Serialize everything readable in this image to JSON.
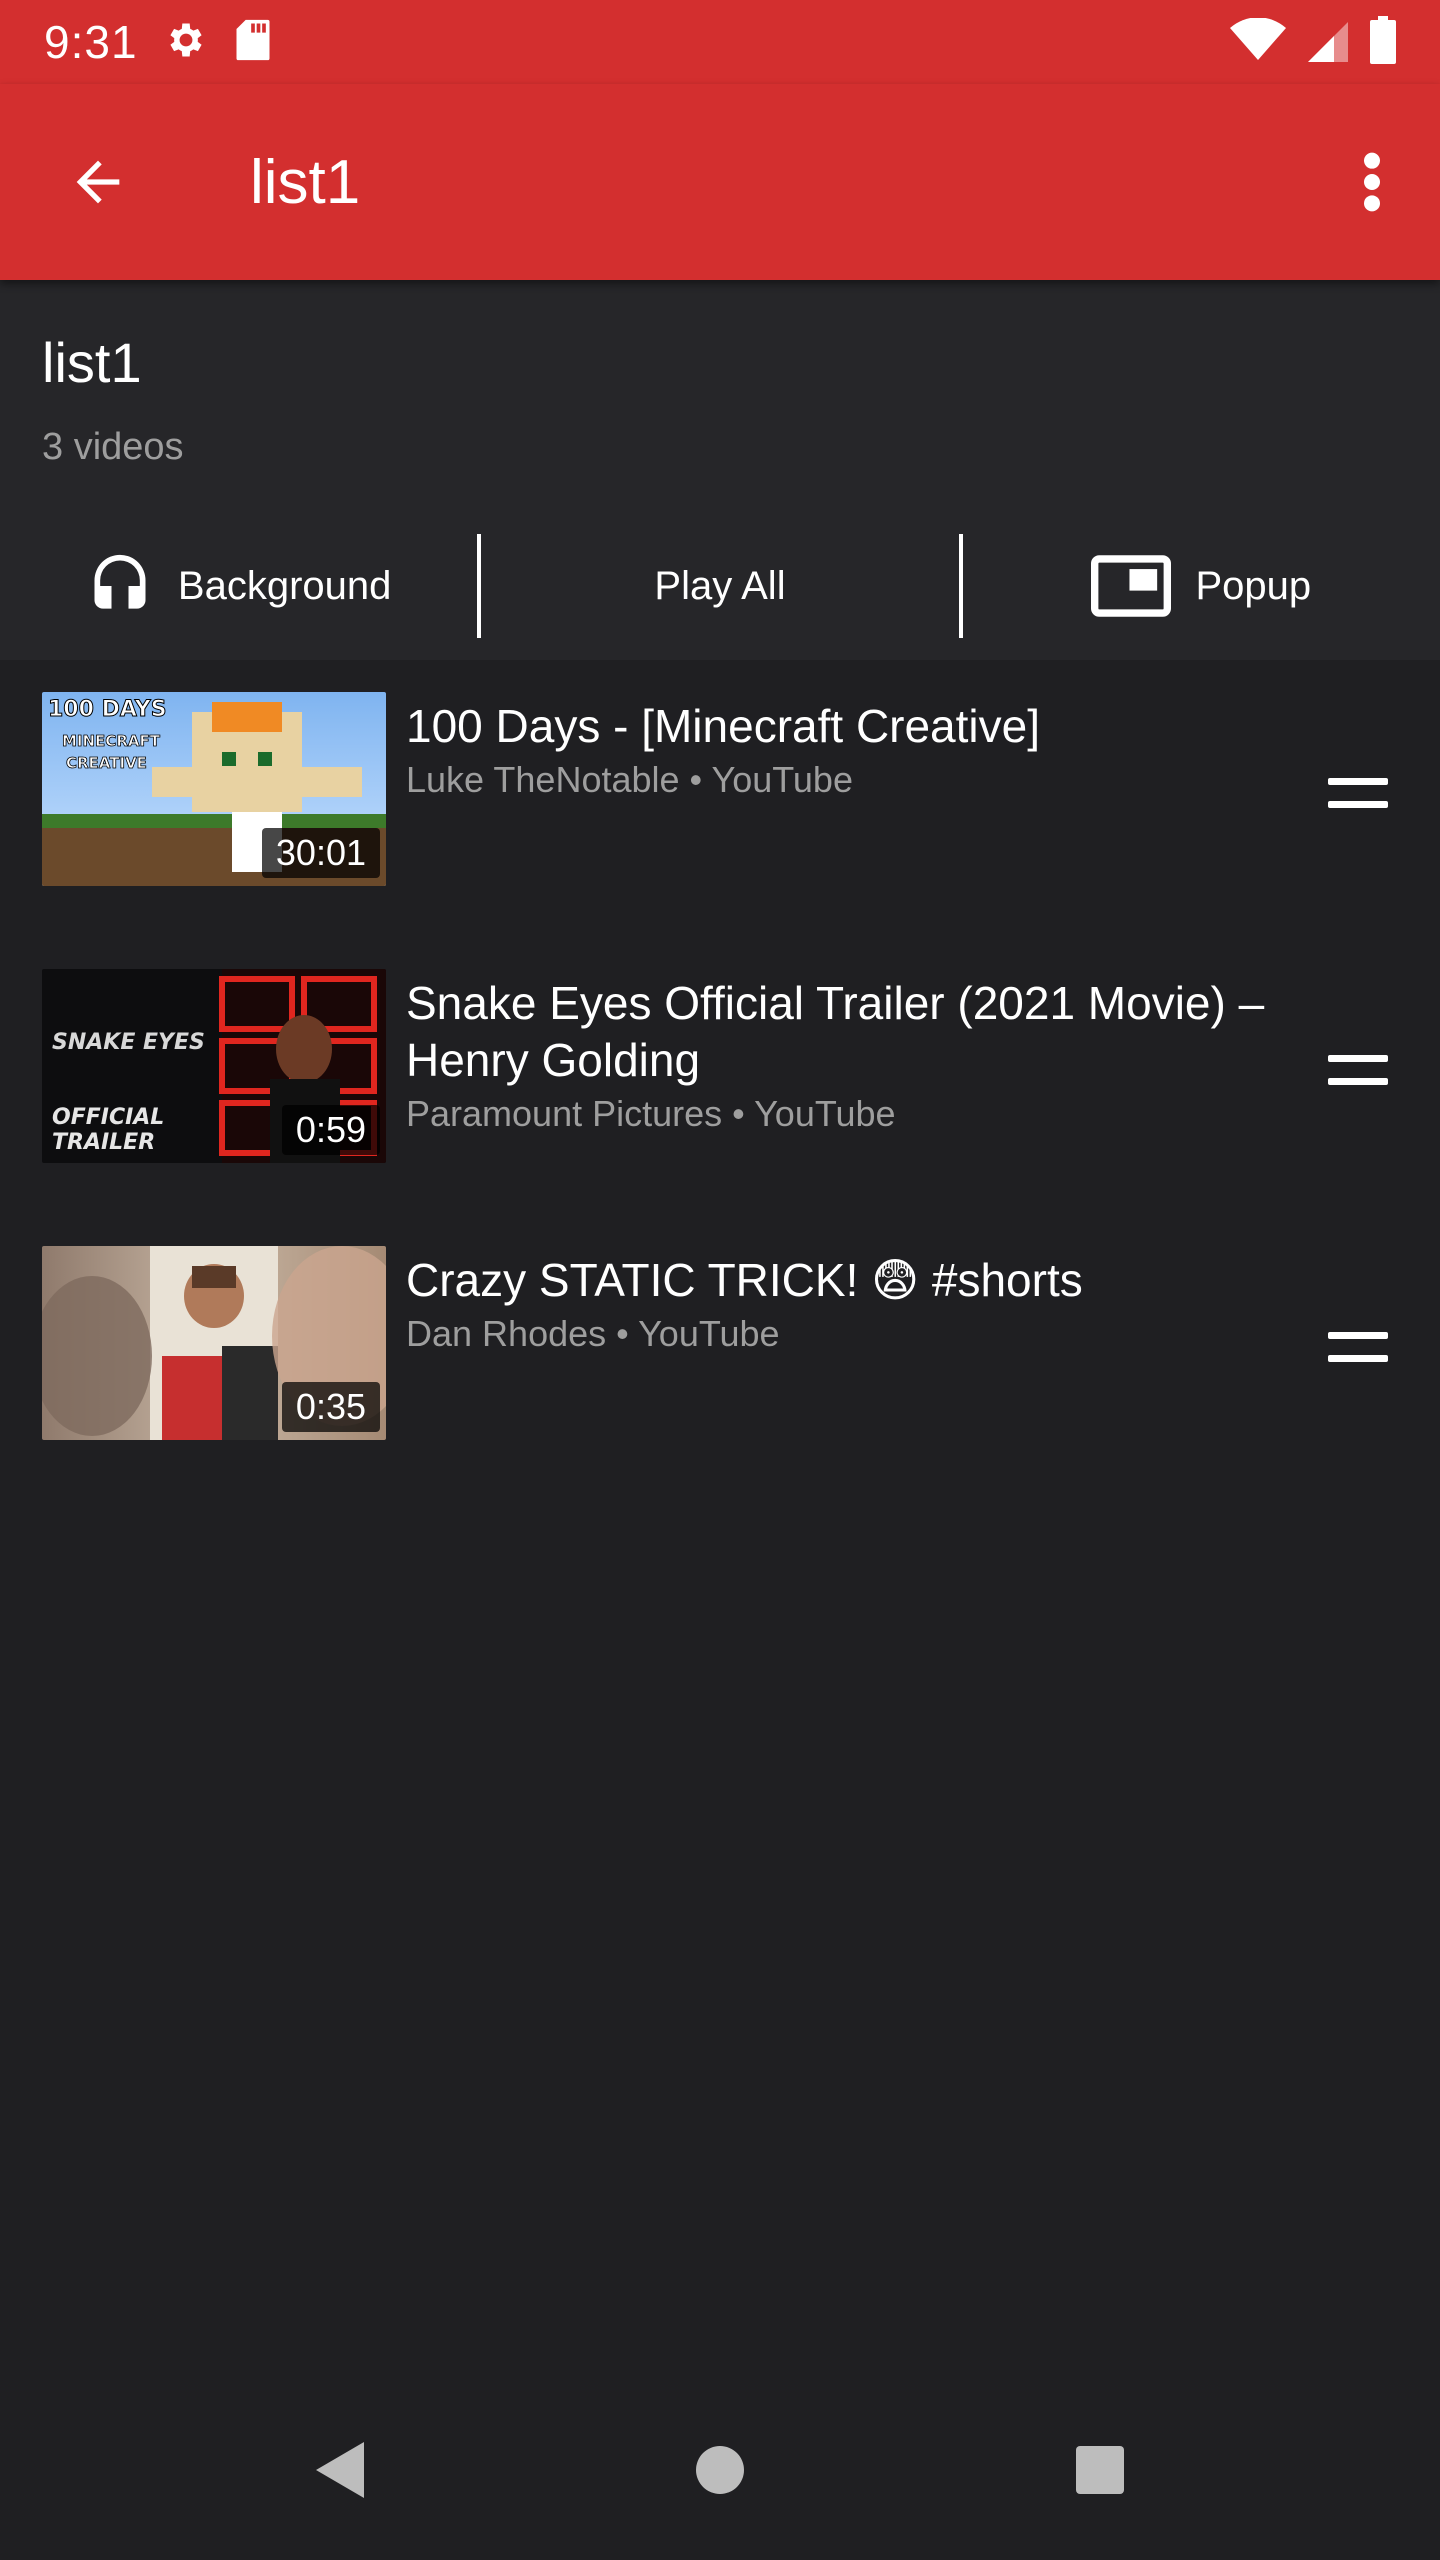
{
  "status_bar": {
    "time": "9:31",
    "icons": [
      "settings-icon",
      "sd-card-icon",
      "wifi-icon",
      "signal-icon",
      "battery-icon"
    ]
  },
  "toolbar": {
    "title": "list1",
    "back_icon": "arrow-back-icon",
    "menu_icon": "more-vert-icon"
  },
  "playlist": {
    "title": "list1",
    "count": "3 videos"
  },
  "actions": {
    "background_label": "Background",
    "play_all_label": "Play All",
    "popup_label": "Popup"
  },
  "videos": [
    {
      "title": "100 Days - [Minecraft Creative]",
      "channel": "Luke TheNotable • YouTube",
      "duration": "30:01",
      "thumb_text_1": "100 DAYS",
      "thumb_text_2": "MINECRAFT",
      "thumb_text_3": "CREATIVE"
    },
    {
      "title": "Snake Eyes Official Trailer (2021 Movie) – Henry Golding",
      "channel": "Paramount Pictures • YouTube",
      "duration": "0:59",
      "thumb_text_1": "SNAKE EYES",
      "thumb_text_2": "OFFICIAL",
      "thumb_text_3": "TRAILER"
    },
    {
      "title": "Crazy STATIC TRICK! 😨 #shorts",
      "channel": "Dan Rhodes • YouTube",
      "duration": "0:35"
    }
  ],
  "colors": {
    "accent": "#d32f2f",
    "background": "#1f1f22",
    "header_bg": "#262629",
    "secondary_text": "#9e9e9e"
  }
}
